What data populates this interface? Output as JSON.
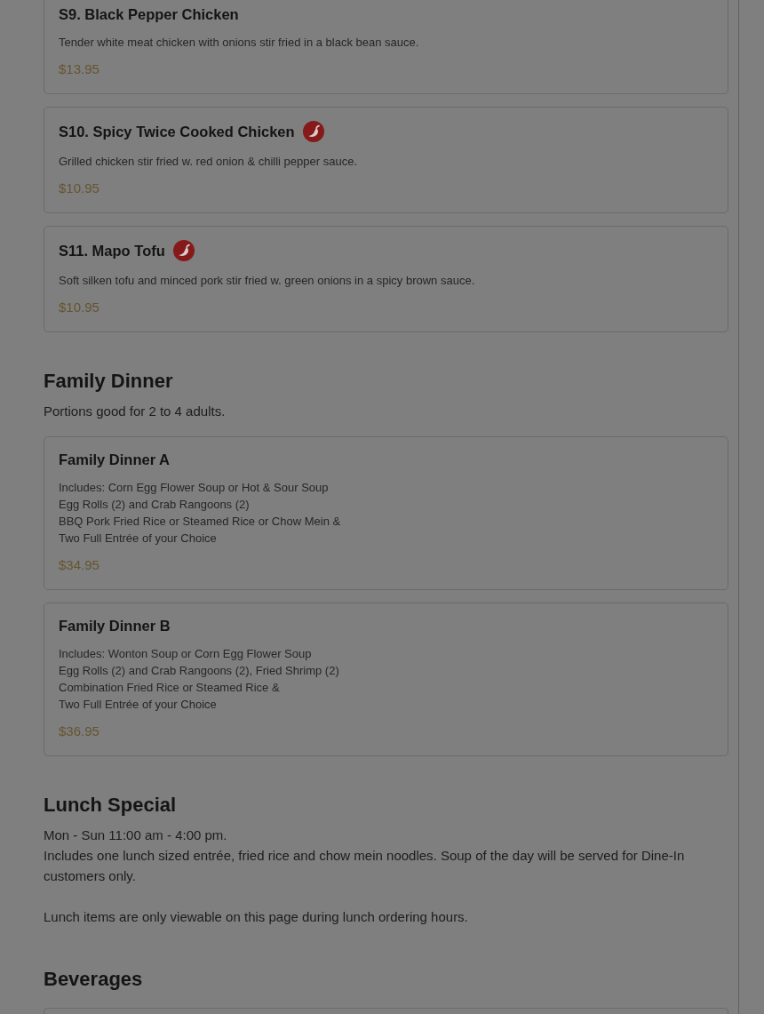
{
  "sections": [
    {
      "kind": "items",
      "items": [
        {
          "name": "S9. Black Pepper Chicken",
          "spicy": false,
          "description": "Tender white meat chicken with onions stir fried in a black bean sauce.",
          "price": "$13.95"
        },
        {
          "name": "S10. Spicy Twice Cooked Chicken",
          "spicy": true,
          "description": "Grilled chicken stir fried w. red onion & chilli pepper sauce.",
          "price": "$10.95"
        },
        {
          "name": "S11. Mapo Tofu",
          "spicy": true,
          "description": "Soft silken tofu and minced pork stir fried w. green onions in a spicy brown sauce.",
          "price": "$10.95"
        }
      ]
    },
    {
      "kind": "items",
      "title": "Family Dinner",
      "subtitle": "Portions good for 2 to 4 adults.",
      "items": [
        {
          "name": "Family Dinner A",
          "spicy": false,
          "description": "Includes: Corn Egg Flower Soup or Hot & Sour Soup\nEgg Rolls (2) and Crab Rangoons (2)\nBBQ Pork Fried Rice or Steamed Rice or Chow Mein &\nTwo Full Entrée of your Choice",
          "price": "$34.95"
        },
        {
          "name": "Family Dinner B",
          "spicy": false,
          "description": "Includes: Wonton Soup or Corn Egg Flower Soup\nEgg Rolls (2) and Crab Rangoons (2), Fried Shrimp (2)\nCombination Fried Rice or Steamed Rice &\nTwo Full Entrée of your Choice",
          "price": "$36.95"
        }
      ]
    },
    {
      "kind": "info",
      "title": "Lunch Special",
      "hours": "Mon - Sun 11:00 am - 4:00 pm.",
      "description": "Includes one lunch sized entrée, fried rice and chow mein noodles. Soup of the day will be served for Dine-In customers only.",
      "note": "Lunch items are only viewable on this page during lunch ordering hours."
    },
    {
      "kind": "continued",
      "title": "Beverages"
    }
  ]
}
